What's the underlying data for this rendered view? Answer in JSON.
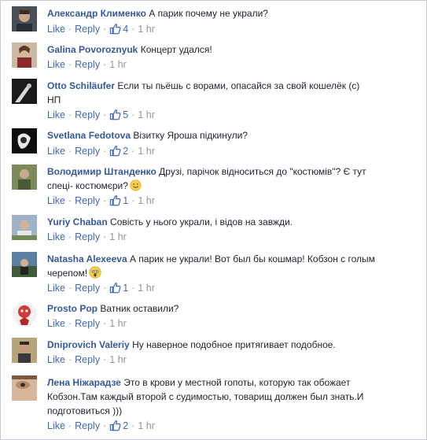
{
  "actions": {
    "like": "Like",
    "reply": "Reply",
    "sep": "·"
  },
  "colors": {
    "name": "#365899",
    "link": "#4267b2",
    "meta": "#90949c",
    "border": "#c4c9d4"
  },
  "comments": [
    {
      "author": "Александр Клименко",
      "text": "А парик почему не украли?",
      "likes": "4",
      "time": "1 hr",
      "avatar": "avatar-photo"
    },
    {
      "author": "Galina Povoroznyuk",
      "text": "Концерт удался!",
      "likes": "",
      "time": "1 hr",
      "avatar": "avatar-photo"
    },
    {
      "author": "Otto Schiläufer",
      "text_line1": "Если ты пьёшь с ворами, опасайся за свой кошелёк (с)",
      "text_line2": "НП",
      "likes": "5",
      "time": "1 hr",
      "avatar": "avatar-photo"
    },
    {
      "author": "Svetlana Fedotova",
      "text": "Візитку Яроша підкинули?",
      "likes": "2",
      "time": "1 hr",
      "avatar": "avatar-photo"
    },
    {
      "author": "Володимир Штанденко",
      "text_line1": "Друзі, парічок відноситься до \"костюмів\"? Є тут",
      "text_line2": "спеці- костюмєри?",
      "emoji": "smile-emoji",
      "likes": "1",
      "time": "1 hr",
      "avatar": "avatar-photo"
    },
    {
      "author": "Yuriy Chaban",
      "text": "Совість у нього украли, і відов на завжди.",
      "likes": "",
      "time": "1 hr",
      "avatar": "avatar-photo"
    },
    {
      "author": "Natasha Alexeeva",
      "text_line1": "А парик не украли! Вот был бы кошмар! Кобзон с голым",
      "text_line2": "черепом!",
      "emoji": "scream-emoji",
      "likes": "1",
      "time": "1 hr",
      "avatar": "avatar-photo"
    },
    {
      "author": "Prosto Pop",
      "text": "Ватник оставили?",
      "likes": "",
      "time": "1 hr",
      "avatar": "avatar-photo"
    },
    {
      "author": "Dniprovich Valeriy",
      "text": "Ну наверное подобное притягивает подобное.",
      "likes": "",
      "time": "1 hr",
      "avatar": "avatar-photo"
    },
    {
      "author": "Лена Ніжарадзе",
      "text_line1": "Это в крови у местной гопоты, которую так обожает",
      "text_line2": "Кобзон.Там каждый второй с судимостью, товарищ должен был знать.И",
      "text_line3": "подготовиться )))",
      "likes": "2",
      "time": "1 hr",
      "avatar": "avatar-photo"
    }
  ]
}
